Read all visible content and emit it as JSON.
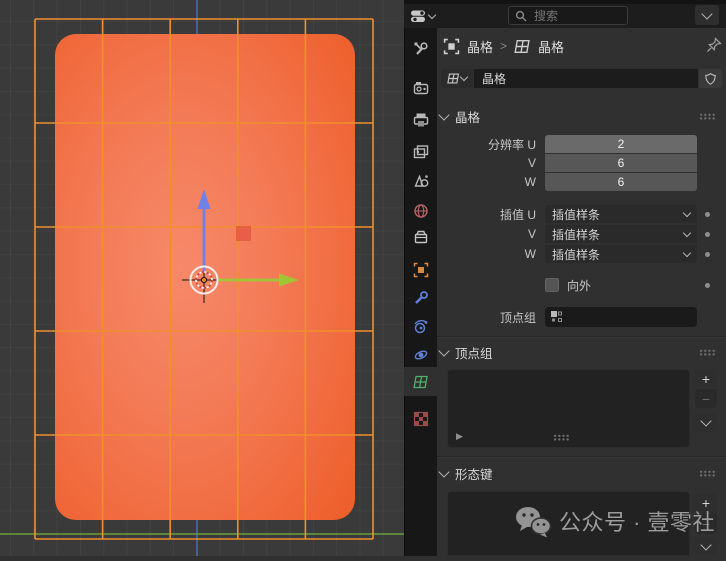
{
  "header": {
    "search_placeholder": "搜索"
  },
  "breadcrumb": {
    "object_label": "晶格",
    "separator": ">",
    "data_label": "晶格"
  },
  "name_field": {
    "value": "晶格"
  },
  "sidebar_tabs": {
    "icons": [
      "tool-icon",
      "render-icon",
      "output-icon",
      "view-layer-icon",
      "scene-icon",
      "world-icon",
      "collection-icon",
      "object-icon",
      "modifiers-wrench-icon",
      "physics-icon",
      "constraints-icon",
      "object-data-lattice-icon",
      "texture-icon"
    ],
    "active": "object-data-lattice-icon"
  },
  "panels": {
    "lattice": {
      "title": "晶格",
      "resolution": {
        "labels": [
          "分辨率 U",
          "V",
          "W"
        ],
        "values": [
          "2",
          "6",
          "6"
        ]
      },
      "interpolation": {
        "labels": [
          "插值 U",
          "V",
          "W"
        ],
        "value": "插值样条"
      },
      "outside": {
        "label": "向外",
        "checked": false
      },
      "vertex_group": {
        "label": "顶点组",
        "value": ""
      }
    },
    "vertex_groups": {
      "title": "顶点组"
    },
    "shape_keys": {
      "title": "形态键"
    }
  },
  "list_buttons": {
    "add": "+",
    "remove": "−",
    "expand": "▶"
  },
  "watermark": {
    "text": "公众号 · 壹零社",
    "logo": "wechat-icon"
  },
  "colors": {
    "lattice_wire": "#ef8f2e",
    "mesh_orange": "#f37a55",
    "axis_z_blue": "#4a6cb8",
    "axis_y_green": "#67a03c",
    "gizmo_green": "#a0c636",
    "gizmo_blue": "#6f81e8",
    "active_tab_green": "#4db36a",
    "panel_bg": "#303030",
    "header_bg": "#1d1d1d"
  }
}
